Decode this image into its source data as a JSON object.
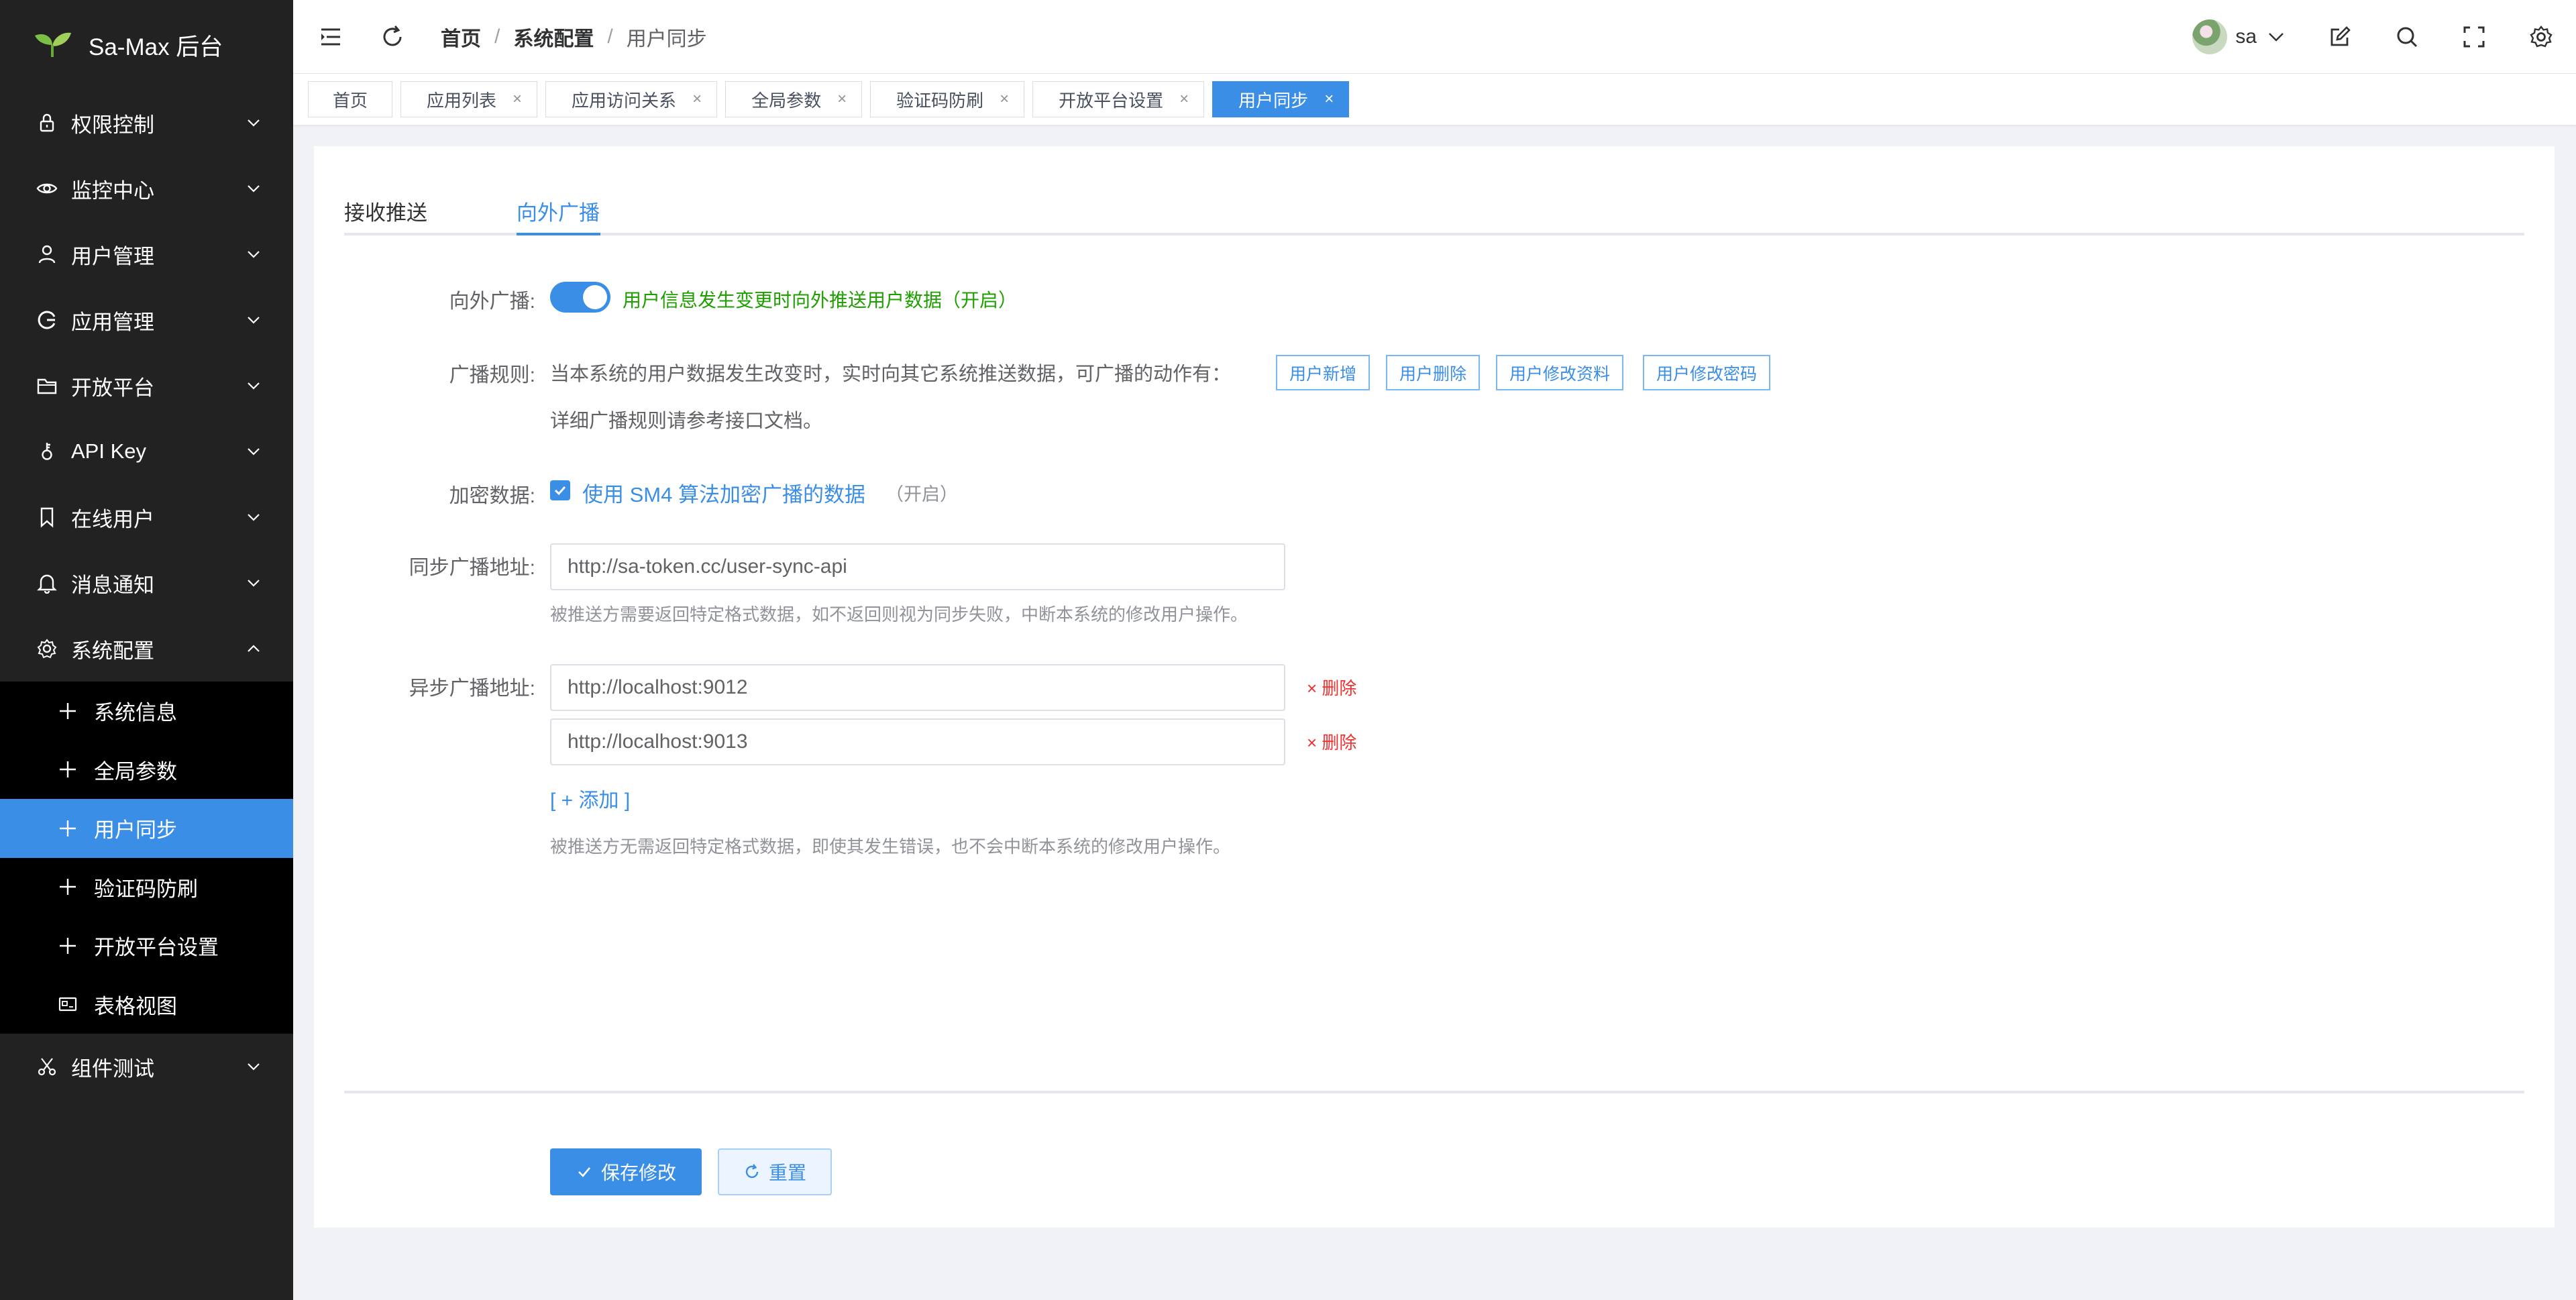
{
  "app": {
    "title": "Sa-Max 后台"
  },
  "sidebar": {
    "items": [
      {
        "label": "权限控制",
        "icon": "lock-icon"
      },
      {
        "label": "监控中心",
        "icon": "eye-icon"
      },
      {
        "label": "用户管理",
        "icon": "user-icon"
      },
      {
        "label": "应用管理",
        "icon": "app-icon"
      },
      {
        "label": "开放平台",
        "icon": "folder-icon"
      },
      {
        "label": "API Key",
        "icon": "key-icon"
      },
      {
        "label": "在线用户",
        "icon": "bookmark-icon"
      },
      {
        "label": "消息通知",
        "icon": "bell-icon"
      },
      {
        "label": "系统配置",
        "icon": "gear-icon"
      }
    ],
    "sub_items": [
      {
        "label": "系统信息",
        "icon": "plus-icon"
      },
      {
        "label": "全局参数",
        "icon": "plus-icon"
      },
      {
        "label": "用户同步",
        "icon": "plus-icon",
        "active": true
      },
      {
        "label": "验证码防刷",
        "icon": "plus-icon"
      },
      {
        "label": "开放平台设置",
        "icon": "plus-icon"
      },
      {
        "label": "表格视图",
        "icon": "table-icon"
      }
    ],
    "last_item": {
      "label": "组件测试",
      "icon": "scissors-icon"
    }
  },
  "header": {
    "breadcrumb": [
      "首页",
      "系统配置",
      "用户同步"
    ],
    "user_name": "sa"
  },
  "tabs": [
    {
      "label": "首页"
    },
    {
      "label": "应用列表"
    },
    {
      "label": "应用访问关系"
    },
    {
      "label": "全局参数"
    },
    {
      "label": "验证码防刷"
    },
    {
      "label": "开放平台设置"
    },
    {
      "label": "用户同步",
      "active": true
    }
  ],
  "content_tabs": [
    "接收推送",
    "向外广播"
  ],
  "form": {
    "broadcast_label": "向外广播:",
    "broadcast_switch_on": true,
    "broadcast_desc": "用户信息发生变更时向外推送用户数据（开启）",
    "rules_label": "广播规则:",
    "rules_text": "当本系统的用户数据发生改变时，实时向其它系统推送数据，可广播的动作有：",
    "rule_tags": [
      "用户新增",
      "用户删除",
      "用户修改资料",
      "用户修改密码"
    ],
    "rules_doc": "详细广播规则请参考接口文档。",
    "encrypt_label": "加密数据:",
    "encrypt_checked": true,
    "encrypt_text": "使用 SM4 算法加密广播的数据",
    "encrypt_suffix": "（开启）",
    "sync_label": "同步广播地址:",
    "sync_url": "http://sa-token.cc/user-sync-api",
    "sync_hint": "被推送方需要返回特定格式数据，如不返回则视为同步失败，中断本系统的修改用户操作。",
    "async_label": "异步广播地址:",
    "async_urls": [
      "http://localhost:9012",
      "http://localhost:9013"
    ],
    "delete_label": "× 删除",
    "add_label": "[ + 添加 ]",
    "async_hint": "被推送方无需返回特定格式数据，即使其发生错误，也不会中断本系统的修改用户操作。",
    "save_label": "保存修改",
    "reset_label": "重置"
  },
  "colors": {
    "accent": "#3a8ee6",
    "sidebar_bg": "#222222",
    "submenu_bg": "#000000",
    "success": "#1e9f00",
    "danger": "#f23030"
  }
}
